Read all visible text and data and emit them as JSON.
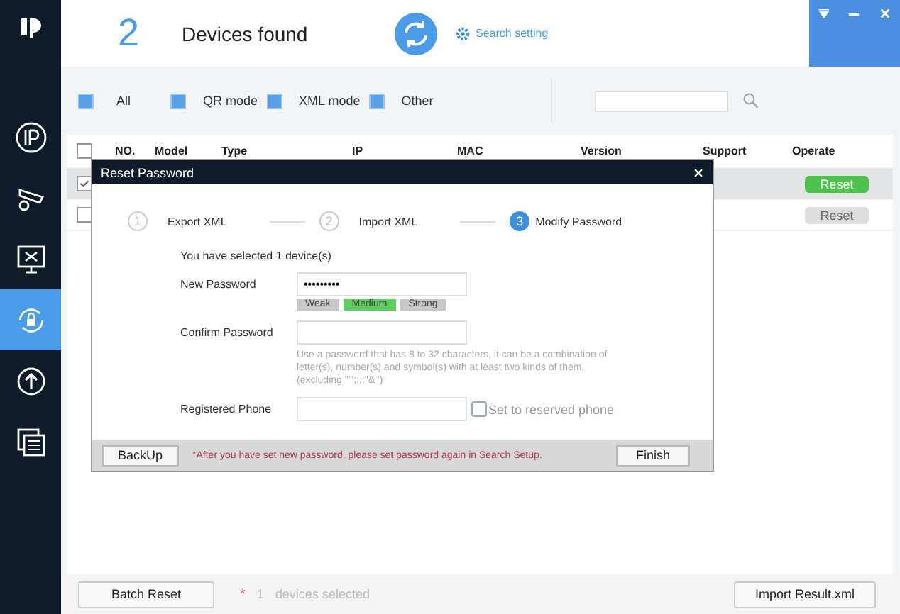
{
  "sidebar": {
    "items": [
      {
        "kind": "ip",
        "selected": false
      },
      {
        "kind": "camera",
        "selected": false
      },
      {
        "kind": "tools",
        "selected": false
      },
      {
        "kind": "lock",
        "selected": true
      },
      {
        "kind": "upload",
        "selected": false
      },
      {
        "kind": "windows",
        "selected": false
      }
    ]
  },
  "header": {
    "count": "2",
    "title": "Devices found",
    "search_setting": "Search setting"
  },
  "filters": [
    {
      "label": "All",
      "checked": true
    },
    {
      "label": "QR mode",
      "checked": true
    },
    {
      "label": "XML mode",
      "checked": true
    },
    {
      "label": "Other",
      "checked": true
    }
  ],
  "table": {
    "select_all_checked": false,
    "columns": [
      "NO.",
      "Model",
      "Type",
      "IP",
      "MAC",
      "Version",
      "Support",
      "Operate"
    ],
    "rows": [
      {
        "checked": true,
        "action": "Reset"
      },
      {
        "checked": false,
        "action": "Reset"
      }
    ]
  },
  "dialog": {
    "title": "Reset Password",
    "steps": [
      {
        "number": "1",
        "label": "Export XML",
        "selected": false
      },
      {
        "number": "2",
        "label": "Import XML",
        "selected": false
      },
      {
        "number": "3",
        "label": "Modify Password",
        "selected": true
      }
    ],
    "selection_note": "You have selected 1 device(s)",
    "new_password_label": "New Password",
    "new_password": "•••••••••",
    "strength": [
      {
        "label": "Weak",
        "selected": false
      },
      {
        "label": "Medium",
        "selected": true
      },
      {
        "label": "Strong",
        "selected": false
      }
    ],
    "confirm_label": "Confirm Password",
    "hint": "Use a password that has 8 to 32 characters, it can be a combination of letter(s), number(s) and symbol(s) with at least two kinds of them. (excluding \"'\";:,:\"& ')",
    "phone_label": "Registered Phone",
    "reserved_phone": {
      "label": "Set to reserved phone",
      "checked": false
    },
    "backup": "BackUp",
    "warning": "*After you have set new password, please set password again in Search Setup.",
    "finish": "Finish"
  },
  "footer": {
    "batch_reset": "Batch Reset",
    "star": "*",
    "selected_count": "1",
    "selected_text": "devices selected",
    "import": "Import Result.xml"
  }
}
